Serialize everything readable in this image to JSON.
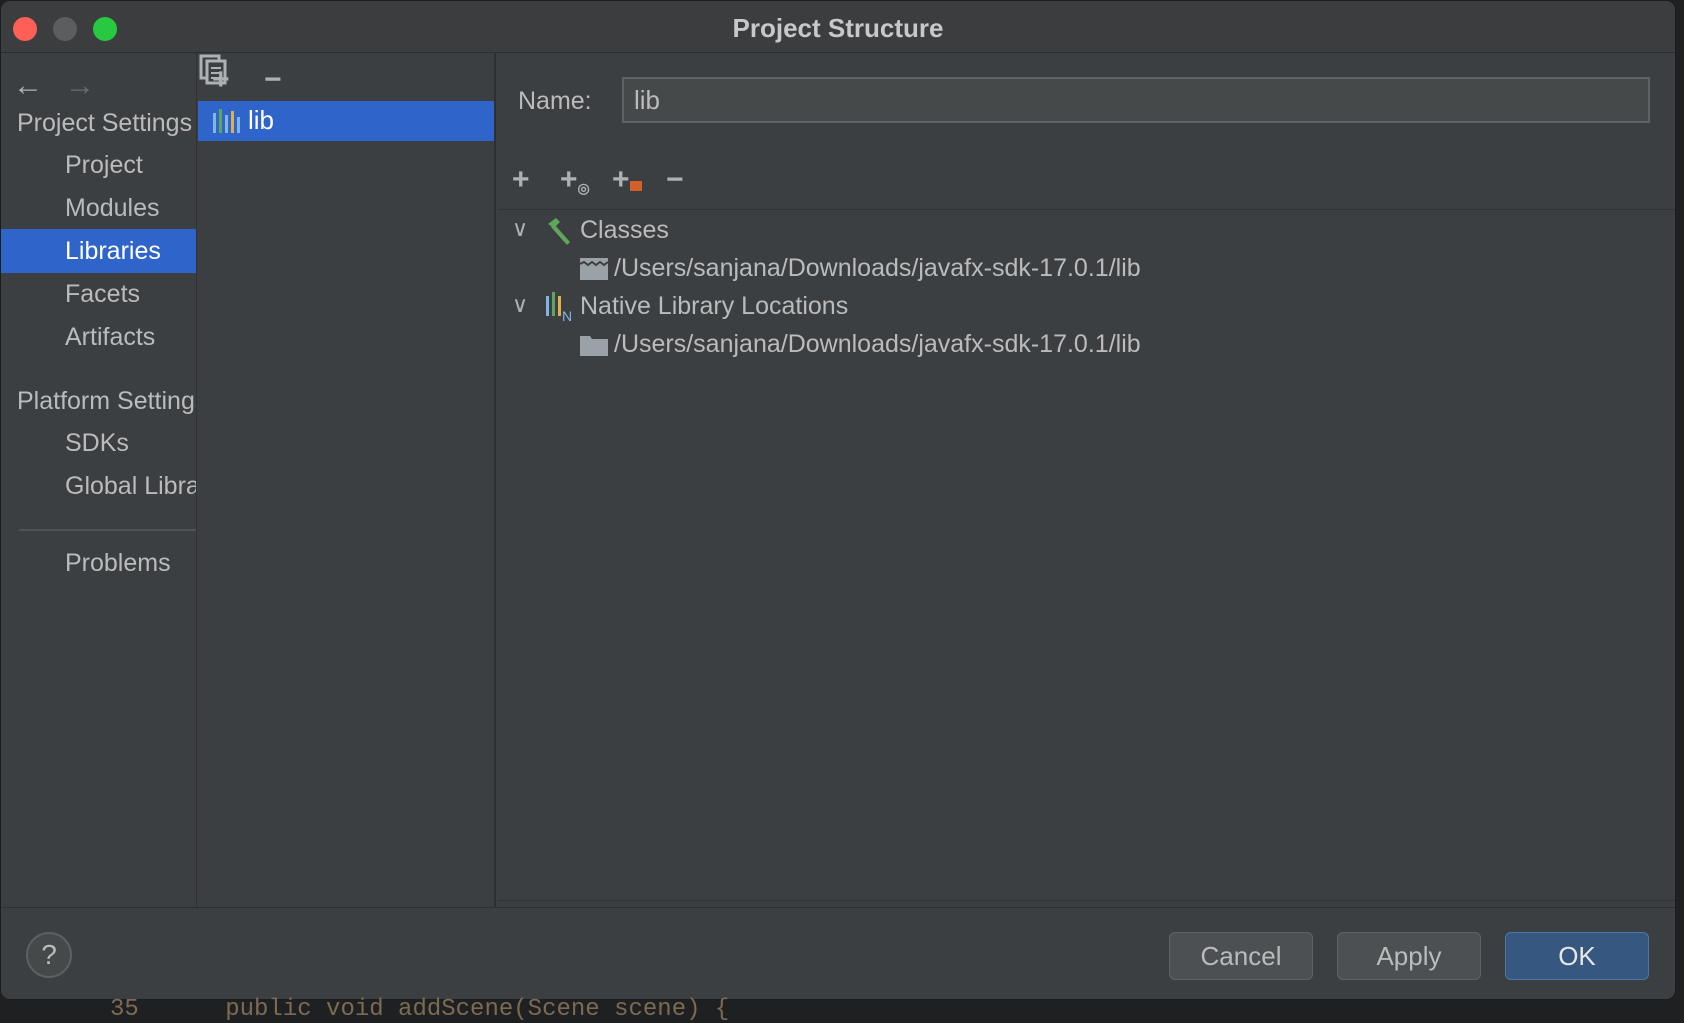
{
  "window": {
    "title": "Project Structure"
  },
  "nav": {
    "sections": [
      {
        "label": "Project Settings",
        "items": [
          "Project",
          "Modules",
          "Libraries",
          "Facets",
          "Artifacts"
        ]
      },
      {
        "label": "Platform Settings",
        "items": [
          "SDKs",
          "Global Libraries"
        ]
      }
    ],
    "selected": "Libraries",
    "problems": "Problems"
  },
  "libraries": {
    "items": [
      {
        "label": "lib",
        "selected": true
      }
    ]
  },
  "detail": {
    "name_label": "Name:",
    "name_value": "lib",
    "tree": [
      {
        "label": "Classes",
        "expanded": true,
        "children": [
          "/Users/sanjana/Downloads/javafx-sdk-17.0.1/lib"
        ]
      },
      {
        "label": "Native Library Locations",
        "expanded": true,
        "children": [
          "/Users/sanjana/Downloads/javafx-sdk-17.0.1/lib"
        ]
      }
    ]
  },
  "footer": {
    "help": "?",
    "cancel": "Cancel",
    "apply": "Apply",
    "ok": "OK"
  },
  "background_code": "35      public void addScene(Scene scene) {",
  "colors": {
    "selection": "#2f65ca",
    "ok_button": "#365880",
    "classes_icon": "#5fa55a"
  }
}
